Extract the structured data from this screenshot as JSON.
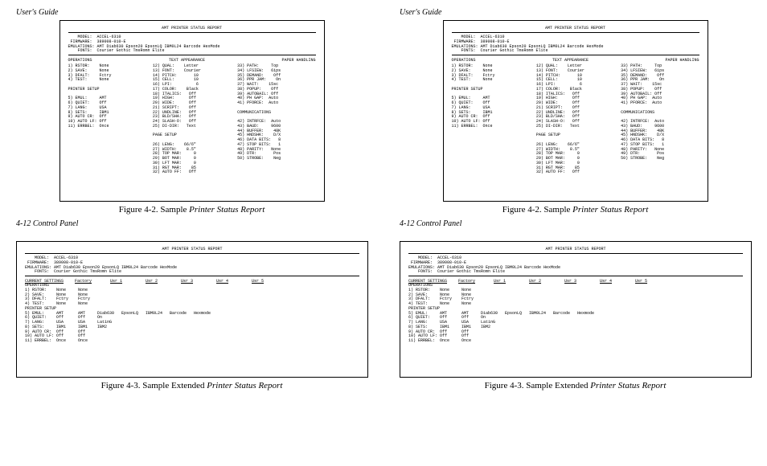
{
  "doc_title": "User's Guide",
  "footer": "4-12 Control Panel",
  "fig42": {
    "caption_prefix": "Figure 4-2.  Sample ",
    "caption_em": "Printer Status Report",
    "report_title": "AMT PRINTER STATUS REPORT",
    "header_block": "    MODEL:  ACCEL-6310\n FIRMWARE:  389008-010-E\nEMULATIONS: AMT Diab630 Epson20 EpsonLQ IBM0L24 Barcode HexMode\n    FONTS:  Courier Gothic TmsRomn Elite",
    "section_headers": {
      "c1": "OPERATIONS",
      "c2": "TEXT APPEARANCE",
      "c3": "PAPER HANDLING"
    },
    "col1": "1) RSTOR:    None\n2) SAVE:     None\n3) DFALT:    Fctry\n4) TEST:     None\n\nPRINTER SETUP\n\n5) EMUL:     AMT\n6) QUIET:    Off\n7) LANG:     USA\n8) SETS:     IBM1\n9) AUTO CR:  Off\n10) AUTO LF: Off\n11) ERRBEL:  Once",
    "col2": "12) QUAL:    Letter\n13) FONT:    Courier\n14) PITCH:       10\n15) CELL:        10\n16) LPI:          6\n17) COLOR:    Black\n18) ITALICS:   Off\n19) HIGH:      Off\n20) WIDE:      Off\n21) SCRIPT:    Off\n22) UNDLINE:   Off\n23) BLD/SHA:   Off\n24) SLASH-O:   Off\n25) DI-DIR:   Text\n\nPAGE SETUP\n\n26) LENG:    66/6\"\n27) WIDTH:    8.5\"\n28) TOP MAR:     0\n29) BOT MAR:     0\n30) LFT MAR:     0\n31) RGT MAR:    85\n32) AUTO FF:   Off",
    "col3": "33) PATH:     Top\n34) LFSIEW:   6ips\n35) DEMAND:    Off\n36) PPR JAM:    On\n37) WAIT:    15sc\n38) POPUP:    Off\n39) AUTOBAIL: Off\n40) PH GAP:  Auto\n41) PFORCE:  Auto\n\nCOMMUNICATIONS\n\n42) INTRFCE:  Auto\n43) BAUD:     9600\n44) BUFFER:    48K\n45) HNDSHK:    D/X\n46) DATA BITS:   8\n47) STOP BITS:   1\n48) PARITY:   None\n49) DTR:       Pos\n50) STROBE:    Neg"
  },
  "fig43": {
    "caption_prefix": "Figure 4-3.  Sample Extended ",
    "caption_em": "Printer Status Report",
    "report_title": "AMT PRINTER STATUS REPORT",
    "header_block": "    MODEL:  ACCEL-6310\n FIRMWARE:  389008-010-E\nEMULATIONS: AMT Diab630 Epson20 EpsonLQ IBM0L24 Barcode HexMode\n    FONTS:  Courier Gothic TmsRomn Elite",
    "columns": [
      "CURRENT SETTINGS",
      "Factory",
      "Usr 1",
      "Usr 2",
      "Usr 3",
      "Usr 4",
      "Usr 5"
    ],
    "section1": "OPERATIONS",
    "rows1": "1) RSTOR:    None     None\n2) SAVE:     None     None\n3) DFALT:    Fctry    Fctry\n4) TEST:     None     None",
    "section2": "PRINTER SETUP",
    "rows2": "5) EMUL:     AMT      AMT     Diab630   EpsonLQ   IBM0L24   Barcode   Hexmode\n6) QUIET:    Off      Off     On\n7) LANG:     USA      USA     LatinG\n8) SETS:     IBM1     IBM1    IBM2\n9) AUTO CR:  Off      Off\n10) AUTO LF: Off      Off\n11) ERRBEL:  Once     Once"
  }
}
